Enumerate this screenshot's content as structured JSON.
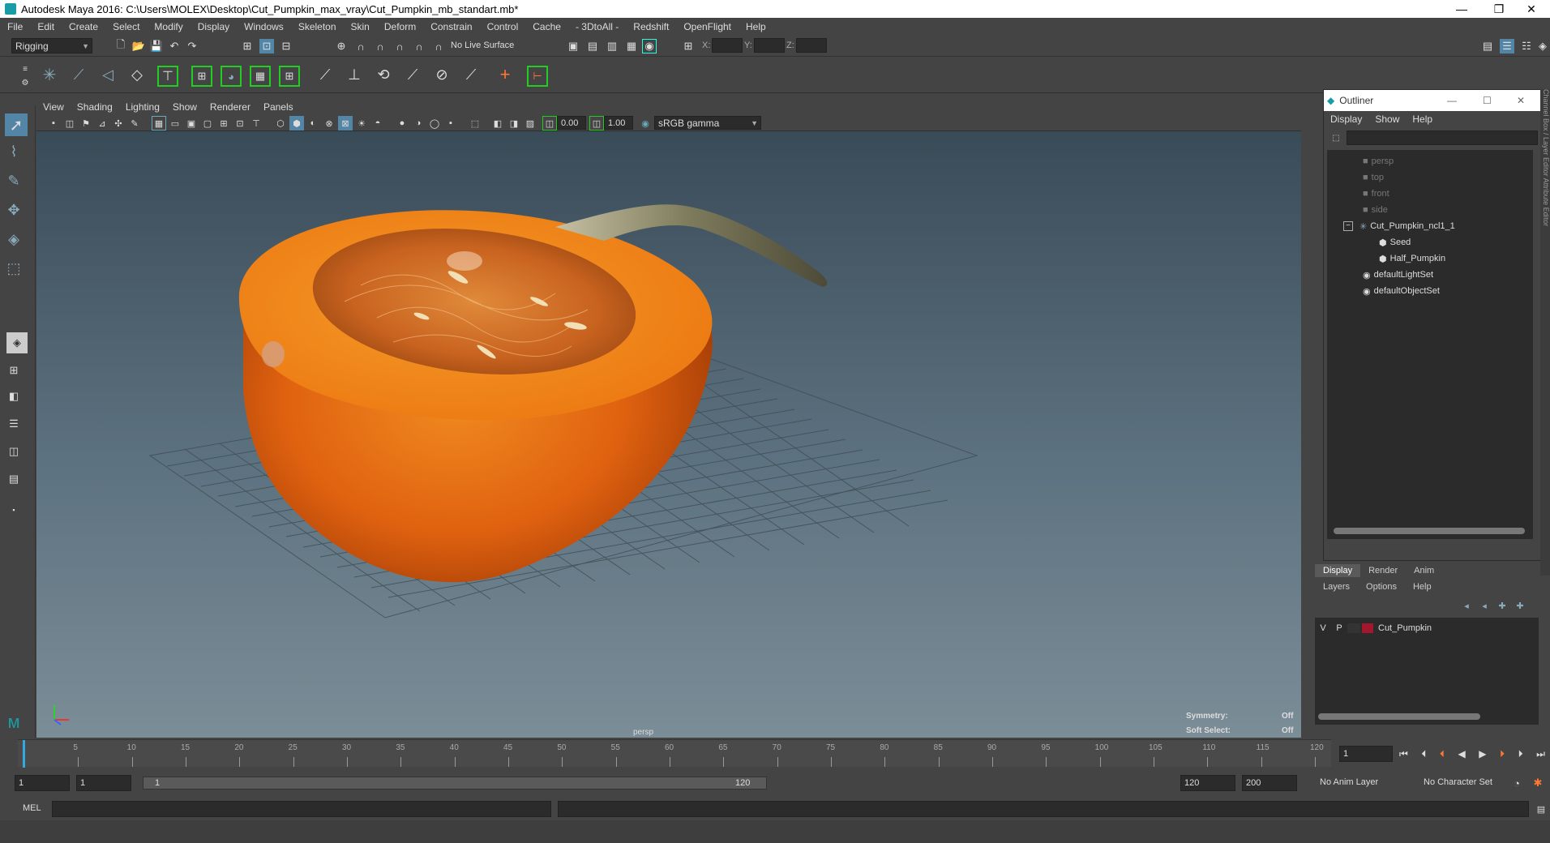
{
  "window": {
    "title": "Autodesk Maya 2016: C:\\Users\\MOLEX\\Desktop\\Cut_Pumpkin_max_vray\\Cut_Pumpkin_mb_standart.mb*",
    "minimize": "—",
    "maximize": "❐",
    "close": "✕"
  },
  "menubar": [
    "File",
    "Edit",
    "Create",
    "Select",
    "Modify",
    "Display",
    "Windows",
    "Skeleton",
    "Skin",
    "Deform",
    "Constrain",
    "Control",
    "Cache",
    "- 3DtoAll -",
    "Redshift",
    "OpenFlight",
    "Help"
  ],
  "toolbar": {
    "mode": "Rigging",
    "live_surface": "No Live Surface",
    "x_label": "X:",
    "y_label": "Y:",
    "z_label": "Z:"
  },
  "viewport": {
    "menu": [
      "View",
      "Shading",
      "Lighting",
      "Show",
      "Renderer",
      "Panels"
    ],
    "exposure": "0.00",
    "gamma": "1.00",
    "color_space": "sRGB gamma",
    "camera": "persp",
    "symmetry_label": "Symmetry:",
    "symmetry_value": "Off",
    "soft_select_label": "Soft Select:",
    "soft_select_value": "Off"
  },
  "outliner": {
    "title": "Outliner",
    "menu": [
      "Display",
      "Show",
      "Help"
    ],
    "items": [
      {
        "label": "persp",
        "dim": true
      },
      {
        "label": "top",
        "dim": true
      },
      {
        "label": "front",
        "dim": true
      },
      {
        "label": "side",
        "dim": true
      },
      {
        "label": "Cut_Pumpkin_ncl1_1",
        "dim": false
      },
      {
        "label": "Seed",
        "dim": false
      },
      {
        "label": "Half_Pumpkin",
        "dim": false
      },
      {
        "label": "defaultLightSet",
        "dim": false
      },
      {
        "label": "defaultObjectSet",
        "dim": false
      }
    ]
  },
  "layer_editor": {
    "tabs": [
      "Display",
      "Render",
      "Anim"
    ],
    "menu": [
      "Layers",
      "Options",
      "Help"
    ],
    "layer": {
      "v": "V",
      "p": "P",
      "name": "Cut_Pumpkin",
      "color": "#a3172d"
    }
  },
  "timeline": {
    "ticks": [
      "5",
      "10",
      "15",
      "20",
      "25",
      "30",
      "35",
      "40",
      "45",
      "50",
      "55",
      "60",
      "65",
      "70",
      "75",
      "80",
      "85",
      "90",
      "95",
      "100",
      "105",
      "110",
      "115",
      "120"
    ],
    "current_frame": "1"
  },
  "range": {
    "start": "1",
    "anim_start": "1",
    "slider_start": "1",
    "slider_end": "120",
    "end": "120",
    "anim_end": "200",
    "anim_layer": "No Anim Layer",
    "character_set": "No Character Set"
  },
  "cmdline": {
    "lang": "MEL"
  },
  "side_tabs": "Channel Box / Layer Editor    Attribute Editor"
}
